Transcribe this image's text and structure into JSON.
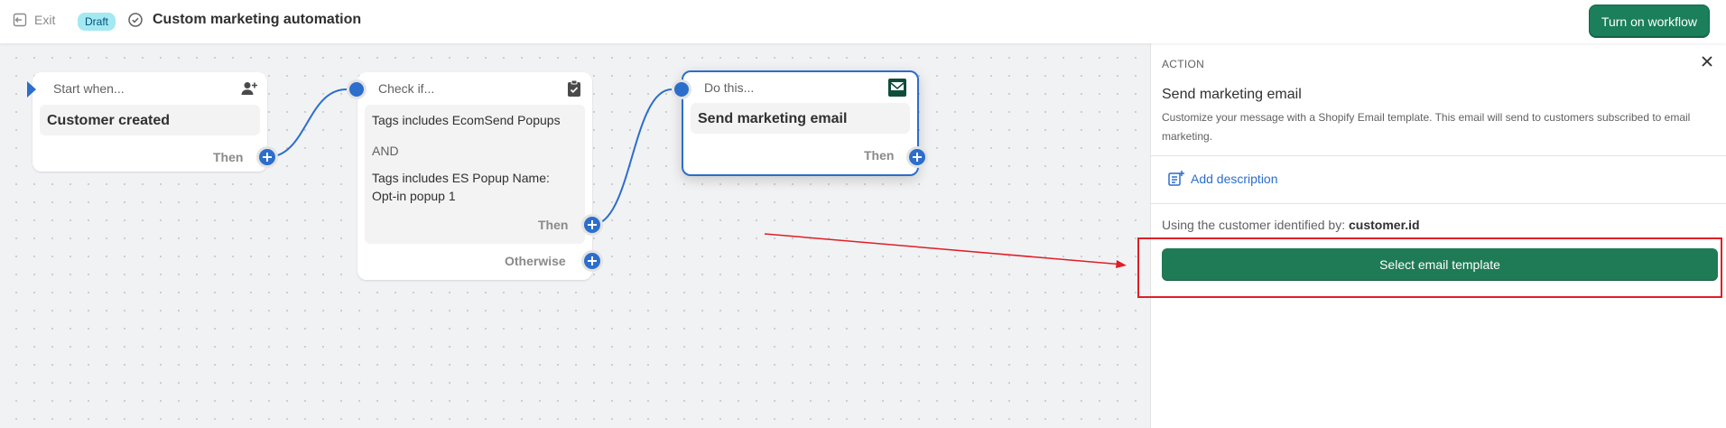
{
  "topbar": {
    "exit_label": "Exit",
    "status_badge": "Draft",
    "title": "Custom marketing automation",
    "turn_on_label": "Turn on workflow"
  },
  "nodes": {
    "start": {
      "label": "Start when...",
      "trigger": "Customer created",
      "then": "Then",
      "icon": "person-add-icon"
    },
    "check": {
      "label": "Check if...",
      "condition_1": "Tags includes EcomSend Popups",
      "operator": "AND",
      "condition_2": "Tags includes ES Popup Name: Opt-in popup 1",
      "then": "Then",
      "otherwise": "Otherwise",
      "icon": "clipboard-check-icon"
    },
    "action": {
      "label": "Do this...",
      "name": "Send marketing email",
      "then": "Then",
      "icon": "email-icon"
    }
  },
  "panel": {
    "kicker": "ACTION",
    "title": "Send marketing email",
    "description": "Customize your message with a Shopify Email template. This email will send to customers subscribed to email marketing.",
    "add_description": "Add description",
    "using_prefix": "Using the customer identified by:",
    "using_value": "customer.id",
    "select_template": "Select email template"
  },
  "colors": {
    "accent": "#2c6ecb",
    "primary_button": "#1a7f5a",
    "annotation": "#e01e27",
    "badge_bg": "#a4e8f2"
  }
}
